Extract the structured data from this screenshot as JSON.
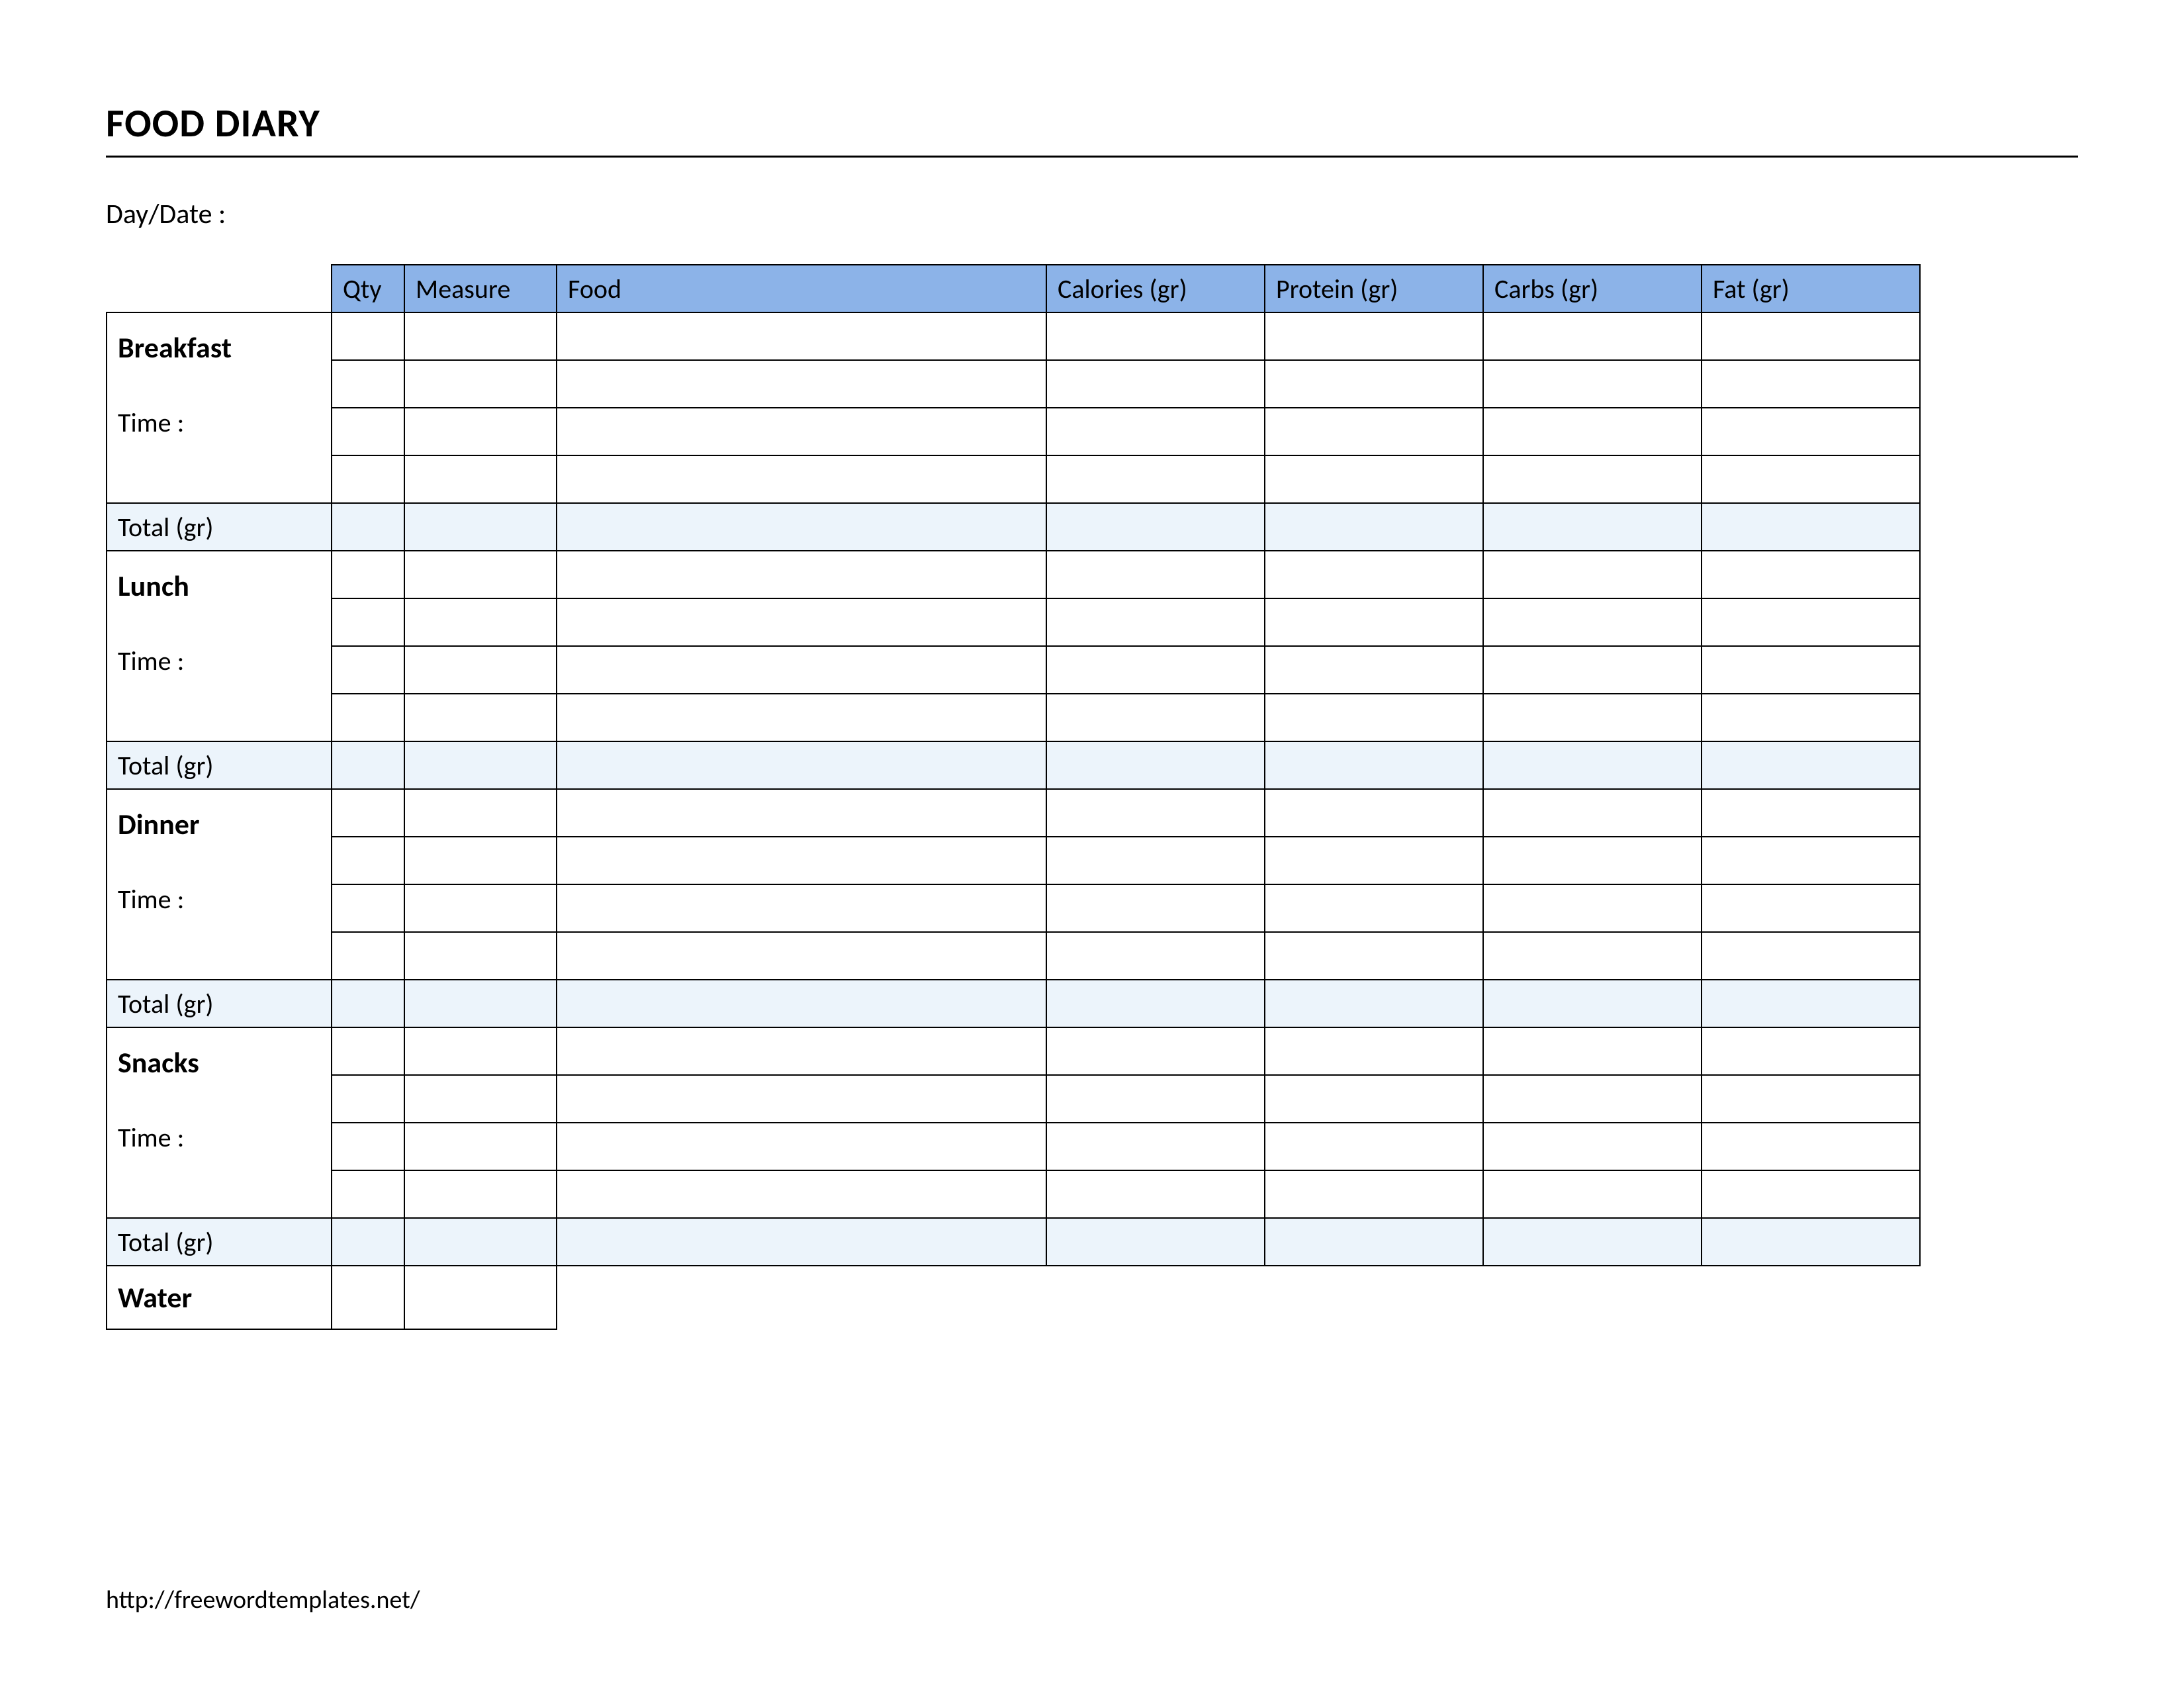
{
  "title": "FOOD DIARY",
  "daydate_label": "Day/Date :",
  "columns": {
    "qty": "Qty",
    "measure": "Measure",
    "food": "Food",
    "calories": "Calories (gr)",
    "protein": "Protein (gr)",
    "carbs": "Carbs (gr)",
    "fat": "Fat (gr)"
  },
  "time_label": "Time :",
  "total_label": "Total (gr)",
  "meals": {
    "breakfast": "Breakfast",
    "lunch": "Lunch",
    "dinner": "Dinner",
    "snacks": "Snacks"
  },
  "water_label": "Water",
  "footer_url": "http://freewordtemplates.net/"
}
